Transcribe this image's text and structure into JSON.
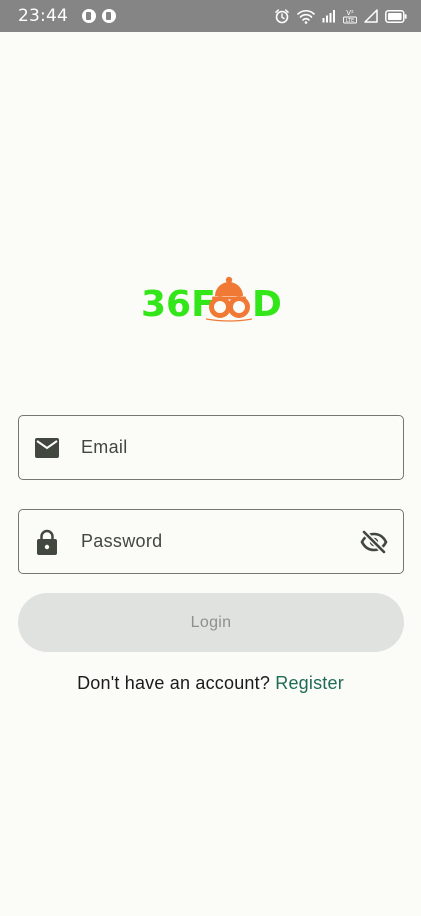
{
  "status_bar": {
    "time": "23:44",
    "notification_icons": [
      "notification-icon",
      "notification-icon"
    ],
    "system_icons": [
      "alarm-icon",
      "wifi-icon",
      "signal-icon",
      "volte-icon",
      "signal-empty-icon",
      "battery-icon"
    ]
  },
  "logo": {
    "text_prefix": "36F",
    "text_suffix": "D",
    "brand_green": "#33e619",
    "brand_orange": "#f07a35"
  },
  "email_field": {
    "placeholder": "Email",
    "icon": "email-icon"
  },
  "password_field": {
    "placeholder": "Password",
    "icon": "lock-icon",
    "toggle_icon": "visibility-off-icon"
  },
  "login_button": {
    "label": "Login"
  },
  "register": {
    "prompt": "Don't have an account?",
    "link_label": "Register",
    "link_color": "#1f6b57"
  }
}
